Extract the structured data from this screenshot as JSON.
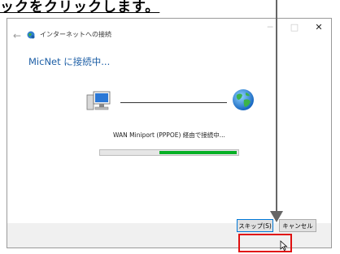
{
  "caption": "ックをクリックします。",
  "window": {
    "controls": {
      "minimize": "─",
      "maximize": "□",
      "close": "✕"
    }
  },
  "header": {
    "back_icon": "←",
    "breadcrumb": "インターネットへの接続"
  },
  "main": {
    "title": "MicNet に接続中...",
    "status": "WAN Miniport (PPPOE) 経由で接続中...",
    "progress": {
      "start": 0.43,
      "end": 0.99
    }
  },
  "buttons": {
    "skip_label": "スキップ(S)",
    "cancel_label": "キャンセル"
  },
  "colors": {
    "title": "#1e5fa6",
    "progress_fill": "#06b025",
    "highlight": "#e01010",
    "pointer": "#666666"
  },
  "icons": {
    "back": "back-arrow-icon",
    "network": "network-globe-icon",
    "computer": "computer-icon",
    "globe": "internet-globe-icon",
    "cursor": "mouse-pointer-icon"
  }
}
